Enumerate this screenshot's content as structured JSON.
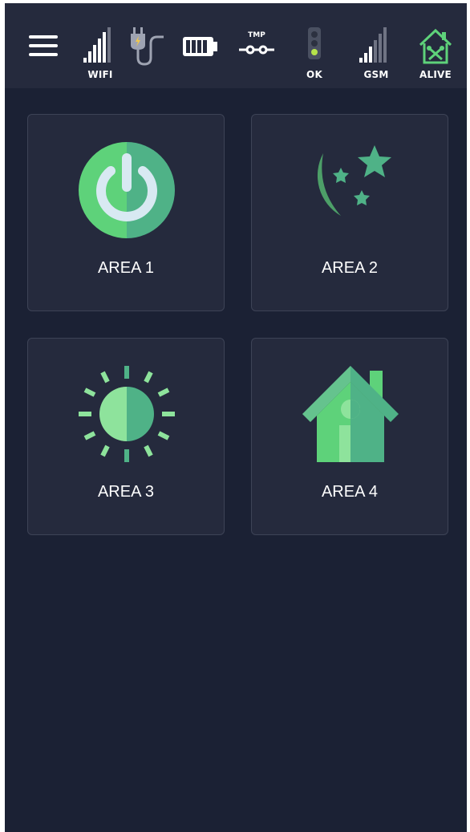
{
  "status_bar": {
    "wifi": {
      "label": "WIFI",
      "icon": "wifi-signal-icon"
    },
    "power": {
      "icon": "power-plug-icon"
    },
    "battery": {
      "icon": "battery-icon"
    },
    "tamper": {
      "label": "TMP",
      "icon": "tamper-switch-icon"
    },
    "traffic": {
      "label": "OK",
      "icon": "traffic-light-icon"
    },
    "gsm": {
      "label": "GSM",
      "icon": "gsm-signal-icon"
    },
    "alive": {
      "label": "ALIVE",
      "icon": "house-tools-icon"
    }
  },
  "areas": [
    {
      "label": "AREA 1",
      "icon": "power-icon"
    },
    {
      "label": "AREA 2",
      "icon": "moon-stars-icon"
    },
    {
      "label": "AREA 3",
      "icon": "sun-icon"
    },
    {
      "label": "AREA 4",
      "icon": "house-icon"
    }
  ],
  "colors": {
    "background": "#1b2134",
    "panel": "#252a3d",
    "accent_green": "#5ed27a",
    "accent_teal": "#4fb287",
    "light_green": "#8ee39c"
  }
}
